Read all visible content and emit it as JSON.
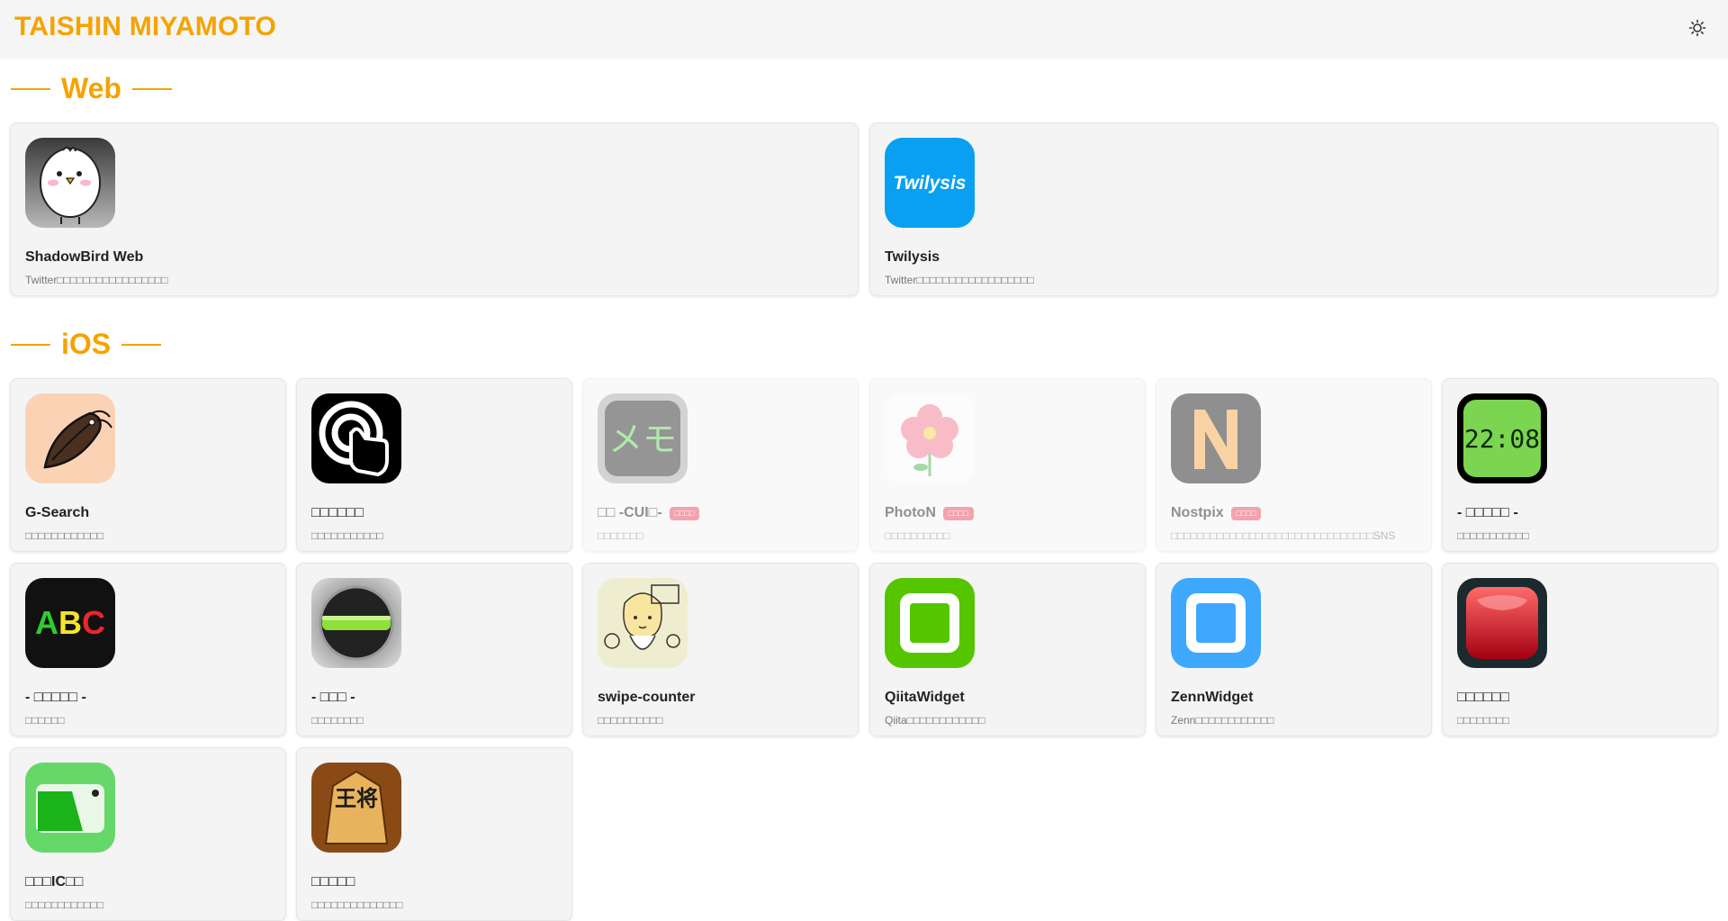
{
  "header": {
    "title": "TAISHIN MIYAMOTO",
    "theme_icon": "sun-icon"
  },
  "colors": {
    "accent": "#f5a300",
    "badge": "#e84a5f",
    "card_bg": "#f4f4f4"
  },
  "sections": {
    "web": {
      "title": "Web",
      "apps": [
        {
          "name": "ShadowBird Web",
          "desc": "Twitter□□□□□□□□□□□□□□□□□",
          "icon": "white-bird-icon"
        },
        {
          "name": "Twilysis",
          "desc": "Twitter□□□□□□□□□□□□□□□□□□",
          "icon": "twilysis-logo-icon",
          "icon_text": "Twilysis"
        }
      ]
    },
    "ios": {
      "title": "iOS",
      "apps": [
        {
          "name": "G-Search",
          "desc": "□□□□□□□□□□□□",
          "icon": "cockroach-icon"
        },
        {
          "name": "□□□□□□",
          "desc": "□□□□□□□□□□□",
          "icon": "tap-hand-icon"
        },
        {
          "name": "□□ -CUI□-",
          "desc": "□□□□□□□",
          "icon": "memo-icon",
          "icon_text": "メモ",
          "badge": "□□□□",
          "disabled": true
        },
        {
          "name": "PhotoN",
          "desc": "□□□□□□□□□□",
          "icon": "flower-icon",
          "badge": "□□□□",
          "disabled": true
        },
        {
          "name": "Nostpix",
          "desc": "□□□□□□□□□□□□□□□□□□□□□□□□□□□□□□□SNS",
          "icon": "nostpix-n-icon",
          "badge": "□□□□",
          "disabled": true
        },
        {
          "name": "- □□□□□ -",
          "desc": "□□□□□□□□□□□",
          "icon": "digital-clock-icon",
          "icon_text": "22:08"
        },
        {
          "name": "- □□□□□ -",
          "desc": "□□□□□□",
          "icon": "abc-led-icon",
          "icon_text": "ABC"
        },
        {
          "name": "- □□□ -",
          "desc": "□□□□□□□□",
          "icon": "level-gauge-icon"
        },
        {
          "name": "swipe-counter",
          "desc": "□□□□□□□□□□",
          "icon": "sketch-girl-icon"
        },
        {
          "name": "QiitaWidget",
          "desc": "Qiita□□□□□□□□□□□□",
          "icon": "qiita-widget-icon"
        },
        {
          "name": "ZennWidget",
          "desc": "Zenn□□□□□□□□□□□□",
          "icon": "zenn-widget-icon"
        },
        {
          "name": "□□□□□□",
          "desc": "□□□□□□□□",
          "icon": "red-button-icon"
        },
        {
          "name": "□□□IC□□",
          "desc": "□□□□□□□□□□□□",
          "icon": "ic-card-icon"
        },
        {
          "name": "□□□□□",
          "desc": "□□□□□□□□□□□□□□",
          "icon": "shogi-king-icon",
          "icon_text": "王将"
        }
      ]
    }
  }
}
